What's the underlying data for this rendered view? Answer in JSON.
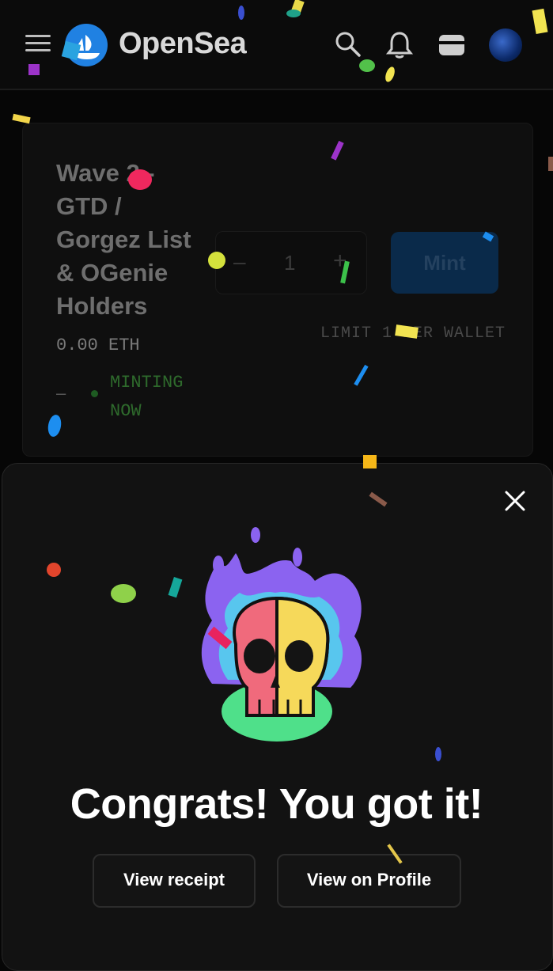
{
  "header": {
    "brand": "OpenSea",
    "icons": [
      "menu-icon",
      "opensea-logo-icon",
      "search-icon",
      "bell-icon",
      "wallet-icon",
      "avatar"
    ]
  },
  "mint_card": {
    "title": "Wave 2 - GTD / Gorgez List & OGenie Holders",
    "price": "0.00 ETH",
    "status_dash": "–",
    "status": "MINTING NOW",
    "stepper": {
      "minus": "–",
      "quantity": "1",
      "plus": "+"
    },
    "mint_label": "Mint",
    "limit": "LIMIT 1 PER WALLET"
  },
  "modal": {
    "close": "×",
    "heading": "Congrats! You got it!",
    "receipt_button": "View receipt",
    "profile_button": "View on Profile"
  },
  "colors": {
    "background": "#060606",
    "brand_blue": "#2081e2",
    "minting_green": "#2e6a2c"
  }
}
